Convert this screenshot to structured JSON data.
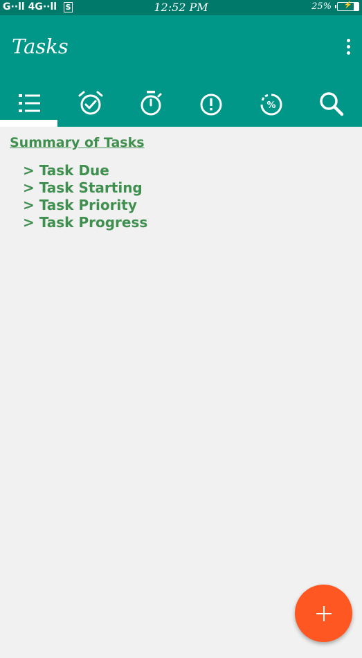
{
  "status_bar": {
    "signal_text": "G∙∙ll 4G∙∙ll",
    "sim_label": "S",
    "time": "12:52 PM",
    "battery": "25%",
    "battery_level": 0.25
  },
  "app_bar": {
    "title": "Tasks"
  },
  "tabs": [
    {
      "id": "list",
      "icon": "list-icon",
      "selected": true
    },
    {
      "id": "due",
      "icon": "alarm-check-icon",
      "selected": false
    },
    {
      "id": "starting",
      "icon": "stopwatch-icon",
      "selected": false
    },
    {
      "id": "priority",
      "icon": "exclamation-icon",
      "selected": false
    },
    {
      "id": "progress",
      "icon": "percent-progress-icon",
      "selected": false
    },
    {
      "id": "search",
      "icon": "search-icon",
      "selected": false
    }
  ],
  "summary": {
    "title": "Summary of Tasks",
    "items": [
      "> Task Due",
      "> Task Starting",
      "> Task Priority",
      "> Task Progress"
    ]
  },
  "fab": {
    "icon": "plus-icon"
  },
  "colors": {
    "status_bar": "#00796b",
    "primary": "#009688",
    "accent": "#ff5722",
    "summary_text": "#3f8f4f",
    "background": "#f1f1f1"
  }
}
